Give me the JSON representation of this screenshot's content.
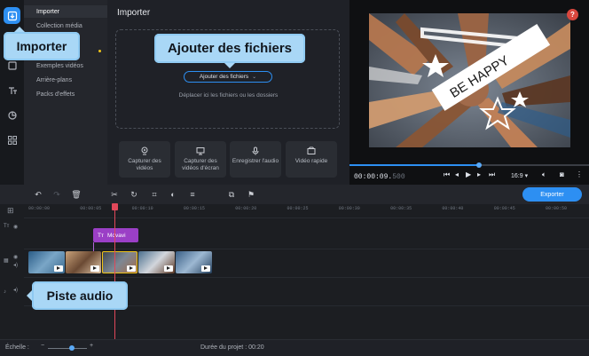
{
  "sidebar": {
    "rail": [
      {
        "icon": "import-icon"
      },
      {
        "icon": "filters-icon"
      },
      {
        "icon": "titles-icon"
      },
      {
        "icon": "transitions-icon"
      },
      {
        "icon": "stickers-icon"
      }
    ]
  },
  "categories": {
    "items": [
      {
        "label": "Importer"
      },
      {
        "label": "Collection média"
      },
      {
        "label": "Exemples vidéos"
      },
      {
        "label": "Arrière-plans"
      },
      {
        "label": "Packs d'effets"
      }
    ]
  },
  "import_panel": {
    "title": "Importer",
    "add_files_label": "Ajouter des fichiers",
    "drop_hint": "Déplacer ici les fichiers ou les dossiers",
    "tiles": [
      {
        "label": "Capturer des vidéos",
        "icon": "webcam-icon"
      },
      {
        "label": "Capturer des vidéos d'écran",
        "icon": "screen-capture-icon"
      },
      {
        "label": "Enregistrer l'audio",
        "icon": "microphone-icon"
      },
      {
        "label": "Vidéo rapide",
        "icon": "quick-video-icon"
      }
    ]
  },
  "callouts": {
    "import": "Importer",
    "add_files": "Ajouter des fichiers",
    "audio_track": "Piste audio"
  },
  "player": {
    "help_label": "?",
    "video_text": "BE HAPPY",
    "timecode_main": "00:00:09.",
    "timecode_frac": "500",
    "aspect_ratio": "16:9 ▾",
    "progress": 0.54
  },
  "toolbar": {
    "export_label": "Exporter"
  },
  "timeline": {
    "ruler": [
      "00:00:00",
      "00:00:05",
      "00:00:10",
      "00:00:15",
      "00:00:20",
      "00:00:25",
      "00:00:30",
      "00:00:35",
      "00:00:40",
      "00:00:45",
      "00:00:50",
      "00:00:55"
    ],
    "title_clip_label": "Movavi"
  },
  "status": {
    "scale_label": "Échelle :",
    "duration_label": "Durée du projet : 00:20"
  },
  "colors": {
    "accent": "#2d8ff2",
    "callout": "#a9d7f6",
    "title_clip": "#9b3fc6",
    "playhead": "#e0485a",
    "help": "#d9473e"
  }
}
